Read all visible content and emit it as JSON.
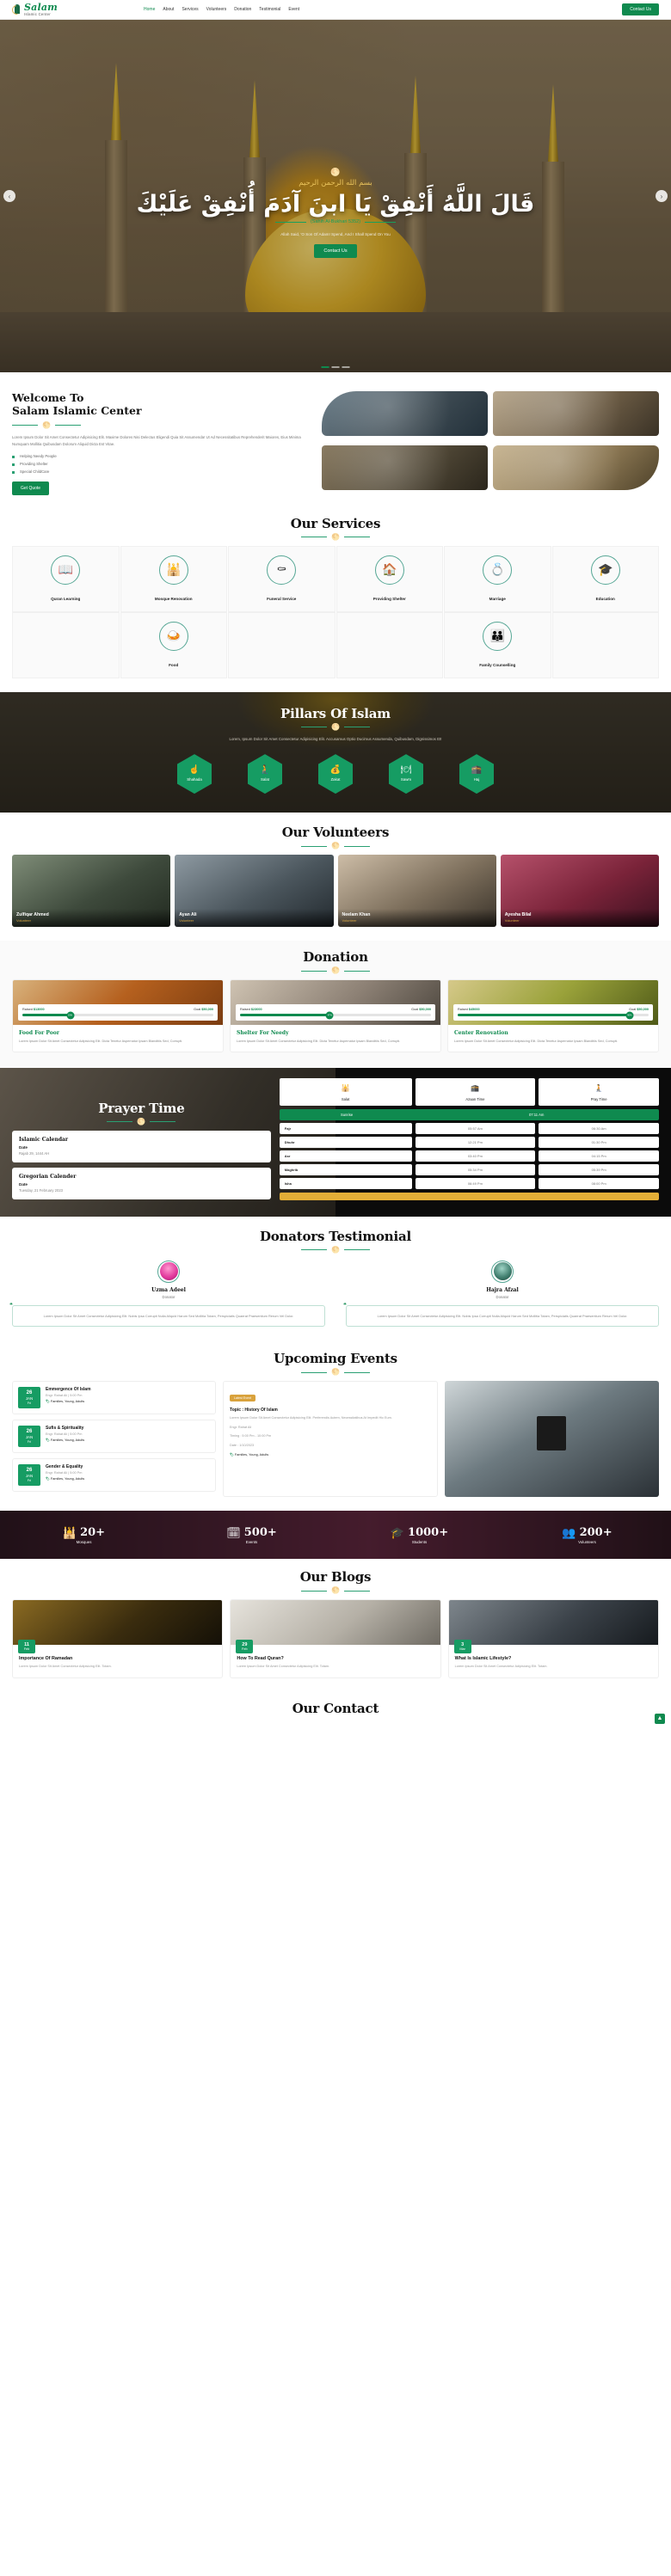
{
  "header": {
    "brand_name": "Salam",
    "brand_sub": "Islamic Center",
    "nav": [
      {
        "label": "Home"
      },
      {
        "label": "About"
      },
      {
        "label": "Services"
      },
      {
        "label": "Volunteers"
      },
      {
        "label": "Donation"
      },
      {
        "label": "Testimonial"
      },
      {
        "label": "Event"
      }
    ],
    "cta": "Contact Us"
  },
  "hero": {
    "bismillah": "بسم الله الرحمن الرحيم",
    "ayah": "قَالَ اللَّهُ أَنْفِقْ يَا ابنَ آدَمَ أُنْفِقْ عَلَيْكَ",
    "reference": "(Sahih Al-Bukhari 5352)",
    "subtitle": "Allah Said, 'O Son Of Adam! Spend, And I Shall Spend On You",
    "button": "Contact Us",
    "prev_icon": "‹",
    "next_icon": "›"
  },
  "welcome": {
    "title_line1": "Welcome To",
    "title_line2": "Salam Islamic Center",
    "paragraph": "Lorem Ipsum Dolor Sit Amet Consectetur Adipisicing Elit. Maxime Dolores Nisi Delectus Eligendi Quia Sit Assumenda! Ut Ad Necessitatibus Reprehenderit Maiores, Eius Minima Numquam Mollitia Quibusdam Dolorum Aliquid Dicta Est Vitae.",
    "list": [
      {
        "label": "Helping Needy People"
      },
      {
        "label": "Providing Shelter"
      },
      {
        "label": "Special ChildCare"
      }
    ],
    "button": "Get Quote"
  },
  "services": {
    "title": "Our Services",
    "items": [
      {
        "label": "Quran Learning",
        "icon": "📖"
      },
      {
        "label": "Mosque Renovation",
        "icon": "🕌"
      },
      {
        "label": "Funeral Service",
        "icon": "⚰"
      },
      {
        "label": "Providing Shelter",
        "icon": "🏠"
      },
      {
        "label": "Marriage",
        "icon": "💍"
      },
      {
        "label": "Education",
        "icon": "🎓"
      },
      {
        "label": "Food",
        "icon": "🍛"
      },
      {
        "label": "Family Counselling",
        "icon": "👪"
      }
    ]
  },
  "pillars": {
    "title": "Pillars Of Islam",
    "description": "Lorem, Ipsum Dolor Sit Amet Consectetur Adipisicing Elit. Accusamus Optio Ducimus Assumenda, Quibusdam, Dignissimos Et!",
    "items": [
      {
        "label": "Shahada",
        "icon": "☝"
      },
      {
        "label": "Salat",
        "icon": "🧎"
      },
      {
        "label": "Zakat",
        "icon": "💰"
      },
      {
        "label": "Sawm",
        "icon": "🍽"
      },
      {
        "label": "Haj",
        "icon": "🕋"
      }
    ]
  },
  "volunteers": {
    "title": "Our Volunteers",
    "items": [
      {
        "name": "Zulfiqar Ahmed",
        "role": "Volunteer"
      },
      {
        "name": "Ayan Ali",
        "role": "Volunteer"
      },
      {
        "name": "Neelam Khan",
        "role": "Volunteer"
      },
      {
        "name": "Ayesha Bilal",
        "role": "Volunteer"
      }
    ]
  },
  "donation": {
    "title": "Donation",
    "raised_label": "Raised",
    "goal_label": "Goal",
    "items": [
      {
        "raised": "$13000",
        "goal": "$50,000",
        "percent": "25%",
        "title": "Food For Poor",
        "desc": "Lorem Ipsum Dolor Sit Amet Consectetur Adipisicing Elit. Dicta Tenetur Aspernatur Ipsam Blanditiis Sed, Corrupti."
      },
      {
        "raised": "$23000",
        "goal": "$50,000",
        "percent": "47%",
        "title": "Shelter For Needy",
        "desc": "Lorem Ipsum Dolor Sit Amet Consectetur Adipisicing Elit. Dicta Tenetur Aspernatur Ipsam Blanditiis Sed, Corrupti."
      },
      {
        "raised": "$45000",
        "goal": "$50,000",
        "percent": "90%",
        "title": "Center Renovation",
        "desc": "Lorem Ipsum Dolor Sit Amet Consectetur Adipisicing Elit. Dicta Tenetur Aspernatur Ipsam Blanditiis Sed, Corrupti."
      }
    ]
  },
  "prayer": {
    "title": "Prayer Time",
    "islamic_calendar": {
      "title": "Islamic Calendar",
      "label": "Date",
      "value": "Rajab 29, 1444 AH"
    },
    "gregorian_calendar": {
      "title": "Gregorian Calender",
      "label": "Date",
      "value": "Tuesday, 21 February 2023"
    },
    "columns": [
      {
        "label": "Salat",
        "icon": "🕌"
      },
      {
        "label": "Azaan Time",
        "icon": "🕋"
      },
      {
        "label": "Pray Time",
        "icon": "🧎"
      }
    ],
    "sunrise": {
      "label": "Sunrise",
      "time": "07:11 Am"
    },
    "rows": [
      {
        "salat": "Fajr",
        "azaan": "05:57 Am",
        "pray": "06:30 Am"
      },
      {
        "salat": "Dhuhr",
        "azaan": "12:21 Pm",
        "pray": "01:30 Pm"
      },
      {
        "salat": "Asr",
        "azaan": "03:40 Pm",
        "pray": "04:15 Pm"
      },
      {
        "salat": "Maghrib",
        "azaan": "05:34 Pm",
        "pray": "05:39 Pm"
      },
      {
        "salat": "Isha",
        "azaan": "06:49 Pm",
        "pray": "08:00 Pm"
      }
    ]
  },
  "testimonial": {
    "title": "Donators Testimonial",
    "items": [
      {
        "name": "Uzma Adeel",
        "role": "Donator",
        "quote": "Lorem Ipsum Dolor Sit Amet Consectetur Adipisicing Elit. Nobis Ipsa Corrupti Nulla Aliquid Harum Sed Mollitia Totam, Perspiciatis Quaerat Praesentium Rerum Vel Dolor."
      },
      {
        "name": "Hajra Afzal",
        "role": "Donator",
        "quote": "Lorem Ipsum Dolor Sit Amet Consectetur Adipisicing Elit. Nobis Ipsa Corrupti Nulla Aliquid Harum Sed Mollitia Totam, Perspiciatis Quaerat Praesentium Rerum Vel Dolor."
      }
    ]
  },
  "events": {
    "title": "Upcoming Events",
    "list": [
      {
        "day": "26",
        "month": "JAN",
        "weekday": "Fri",
        "name": "Emmergence Of Islam",
        "speaker": "Engr. Rahat Ali | 5:00 Pm",
        "audience": "Families, Young, Adults"
      },
      {
        "day": "26",
        "month": "JAN",
        "weekday": "Fri",
        "name": "Sufis & Spirituality",
        "speaker": "Engr. Rahat Ali | 5:00 Pm",
        "audience": "Families, Young, Adults"
      },
      {
        "day": "26",
        "month": "JAN",
        "weekday": "Fri",
        "name": "Gender & Equality",
        "speaker": "Engr. Rahat Ali | 5:00 Pm",
        "audience": "Families, Young, Adults"
      }
    ],
    "featured": {
      "badge": "Latest Event",
      "topic_label": "Topic :",
      "topic": "History Of Islam",
      "desc": "Lorem Ipsum Dolor Sit Amet Consectetur Adipisicing Elit. Perferendis Autem, Necessitatibus At Impedit Hic Eum.",
      "speaker": "Engr. Rahat Ali",
      "time": "Timing : 5:00 Pm - 10:00 Pm",
      "date": "Date : 1/10/2023",
      "audience": "Families, Young, Adults"
    }
  },
  "stats": [
    {
      "icon": "🕌",
      "value": "20+",
      "caption": "Mosques"
    },
    {
      "icon": "🗓",
      "value": "500+",
      "caption": "Events"
    },
    {
      "icon": "🎓",
      "value": "1000+",
      "caption": "Students"
    },
    {
      "icon": "👥",
      "value": "200+",
      "caption": "Volunteers"
    }
  ],
  "blogs": {
    "title": "Our Blogs",
    "items": [
      {
        "day": "11",
        "month": "Feb",
        "title": "Importance Of Ramadan",
        "desc": "Lorem Ipsum Dolor Sit Amet Consectetur Adipisicing Elit. Totam."
      },
      {
        "day": "29",
        "month": "Feb",
        "title": "How To Read Quran?",
        "desc": "Lorem Ipsum Dolor Sit Amet Consectetur Adipisicing Elit. Totam."
      },
      {
        "day": "3",
        "month": "Mar",
        "title": "What Is Islamic Lifestyle?",
        "desc": "Lorem Ipsum Dolor Sit Amet Consectetur Adipisicing Elit. Totam."
      }
    ]
  },
  "contact": {
    "title": "Our Contact"
  },
  "to_top_icon": "▲",
  "colors": {
    "primary": "#0f8a4f",
    "accent": "#169c63",
    "gold": "#d9a23c",
    "teal": "#2aa073"
  }
}
